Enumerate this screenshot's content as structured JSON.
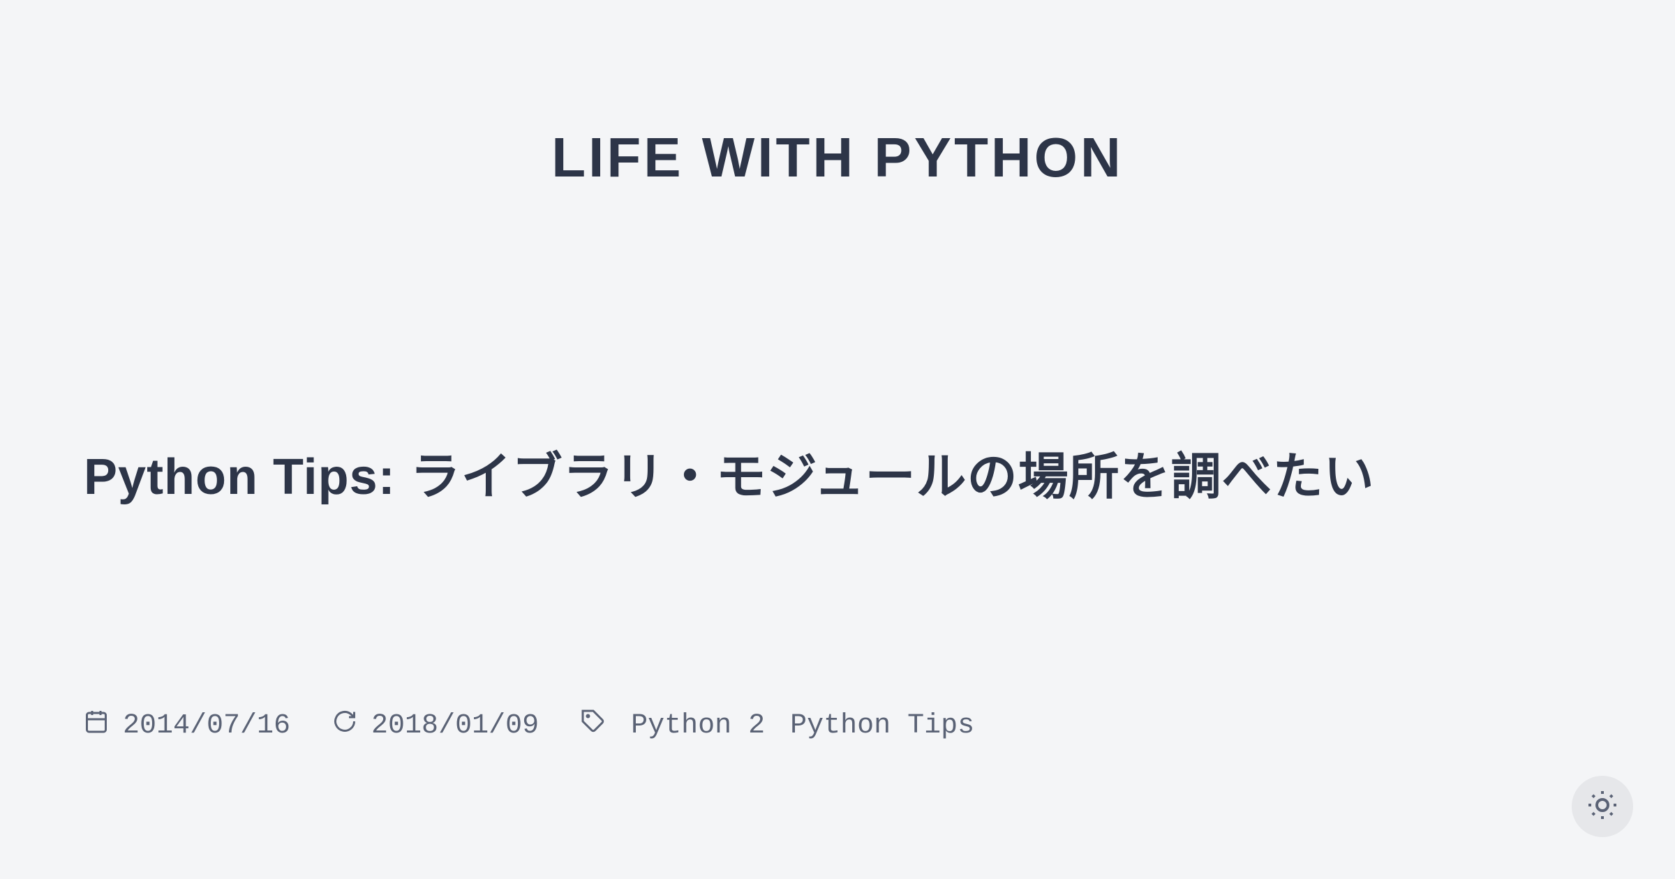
{
  "header": {
    "site_title": "LIFE WITH PYTHON"
  },
  "article": {
    "title": "Python Tips: ライブラリ・モジュールの場所を調べたい",
    "published_date": "2014/07/16",
    "updated_date": "2018/01/09",
    "tags": [
      "Python 2",
      "Python Tips"
    ]
  }
}
